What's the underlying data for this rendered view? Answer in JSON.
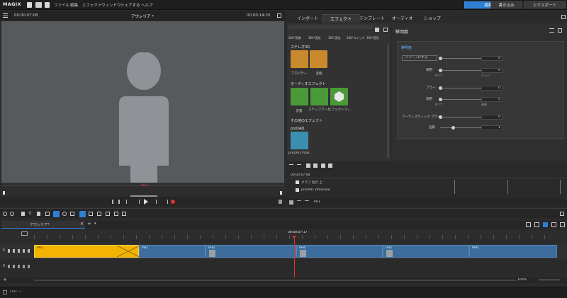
{
  "app": {
    "logo": "MAGIX",
    "menu": [
      "ファイル",
      "編集",
      "エフェクト",
      "ウィンドウ",
      "シェアする",
      "ヘルプ"
    ],
    "modes": [
      "編集",
      "書き込み",
      "エクスポート"
    ],
    "active_mode": "編集"
  },
  "preview": {
    "time_left": "00:00:07:08",
    "title": "アウレリア *",
    "time_right": "00:00:14:20",
    "marker_label": "2617"
  },
  "tabs": [
    "インポート",
    "エフェクト",
    "テンプレート",
    "オーディオ",
    "ショップ"
  ],
  "effects": {
    "top_row": [
      "360°画像",
      "360°変化",
      "360°変化",
      "360°ステッチ",
      "360°変形"
    ],
    "sections": [
      {
        "name": "ステレオ3D",
        "items": [
          "プロパティ",
          "変換"
        ]
      },
      {
        "name": "オーディオエフェクト",
        "items": [
          "音量",
          "ステップアーカー",
          "エフェクトマップシート"
        ]
      },
      {
        "name": "その他のエフェクト",
        "items": []
      },
      {
        "name": "proDAD",
        "items": [
          "proDAD Vitascene"
        ]
      }
    ]
  },
  "properties": {
    "title": "鮮明度",
    "section": "鮮明度",
    "rows": [
      {
        "label": "シャープにする",
        "value": "0",
        "sub": []
      },
      {
        "label": "適用",
        "value": "0",
        "sub": [
          "すべて",
          "エッジ"
        ]
      },
      {
        "label": "ブラー",
        "value": "0",
        "sub": []
      },
      {
        "label": "適用",
        "value": "0",
        "sub": [
          "すべて",
          "表面"
        ]
      },
      {
        "label": "アーティスティック ブラー",
        "value": "0",
        "sub": []
      },
      {
        "label": "品質",
        "value": "1",
        "sub": []
      }
    ]
  },
  "keyframes": {
    "time": "00:00:07:08",
    "rows": [
      "クラフ 合計 上",
      "proDAD Vitascene"
    ]
  },
  "timeline": {
    "tab_label": "アウレリア*",
    "playhead_time": "00:00:07:17",
    "clips": [
      "PH1",
      "PH2",
      "PH3",
      "PH4",
      "PH5",
      "PH6"
    ],
    "zoom": "100%",
    "status_cpu": "CPU: —"
  },
  "colors": {
    "accent": "#2f7fd6",
    "clip_yellow": "#f2b400",
    "clip_blue": "#3c6d9c",
    "playhead": "#e03030"
  }
}
